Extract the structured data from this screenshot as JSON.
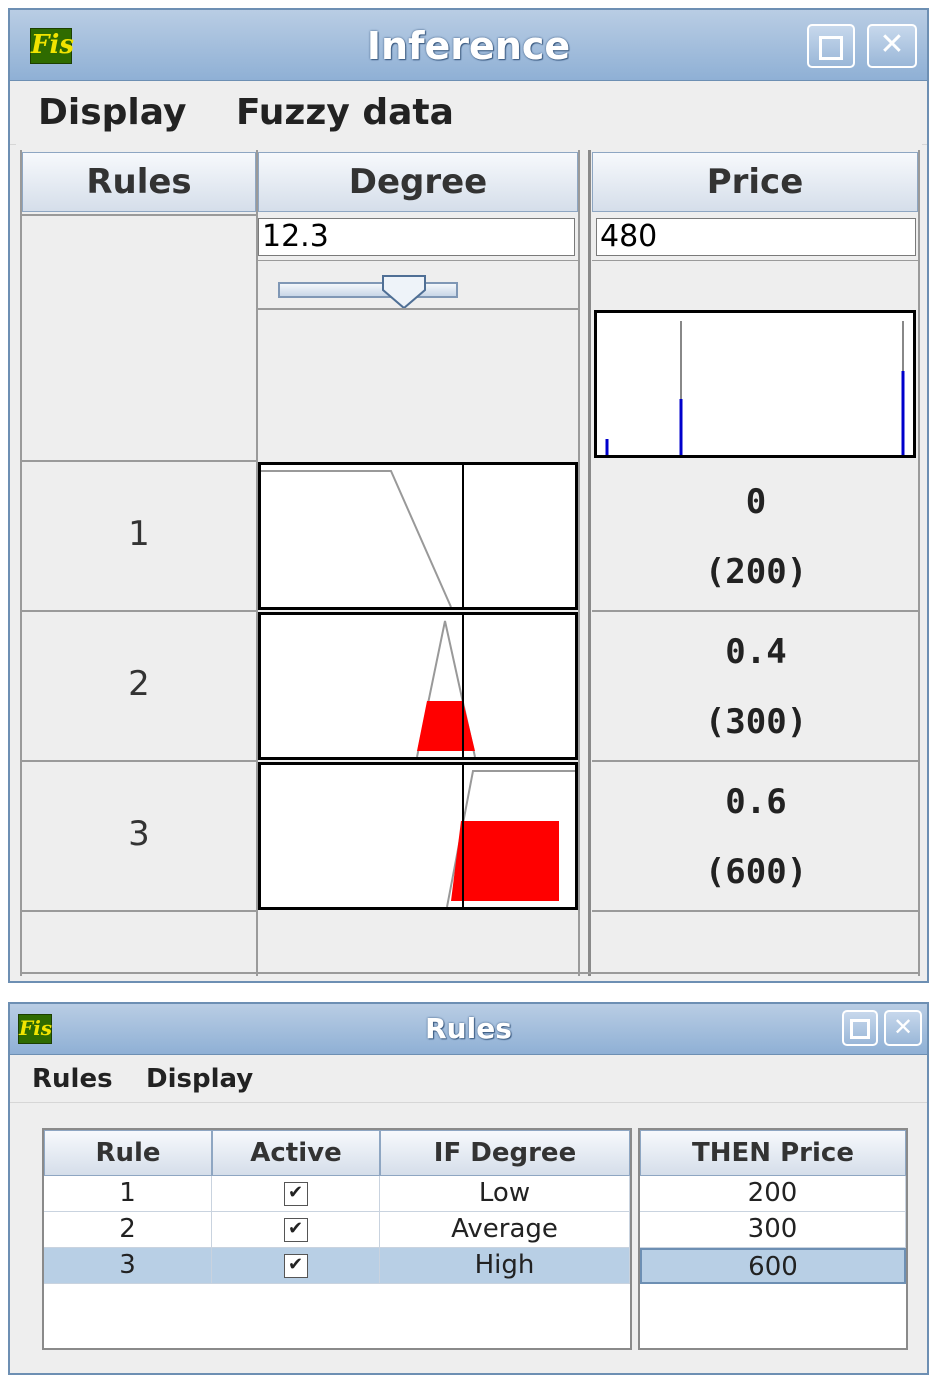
{
  "inference": {
    "title": "Inference",
    "logo": "Fis",
    "menu": [
      "Display",
      "Fuzzy data"
    ],
    "headers": {
      "rules": "Rules",
      "degree": "Degree",
      "price": "Price"
    },
    "degree_value": "12.3",
    "slider_fraction": 0.6,
    "price_value": "480",
    "rules": [
      {
        "num": "1",
        "degree": "0",
        "price": "(200)"
      },
      {
        "num": "2",
        "degree": "0.4",
        "price": "(300)"
      },
      {
        "num": "3",
        "degree": "0.6",
        "price": "(600)"
      }
    ],
    "colors": {
      "fill": "#ff0000",
      "bar": "#0000cc"
    }
  },
  "rules_window": {
    "title": "Rules",
    "logo": "Fis",
    "menu": [
      "Rules",
      "Display"
    ],
    "columns": [
      "Rule",
      "Active",
      "IF Degree",
      "THEN Price"
    ],
    "rows": [
      {
        "rule": "1",
        "active": "✔",
        "if": "Low",
        "then": "200"
      },
      {
        "rule": "2",
        "active": "✔",
        "if": "Average",
        "then": "300"
      },
      {
        "rule": "3",
        "active": "✔",
        "if": "High",
        "then": "600"
      }
    ],
    "selected_row": 3
  }
}
